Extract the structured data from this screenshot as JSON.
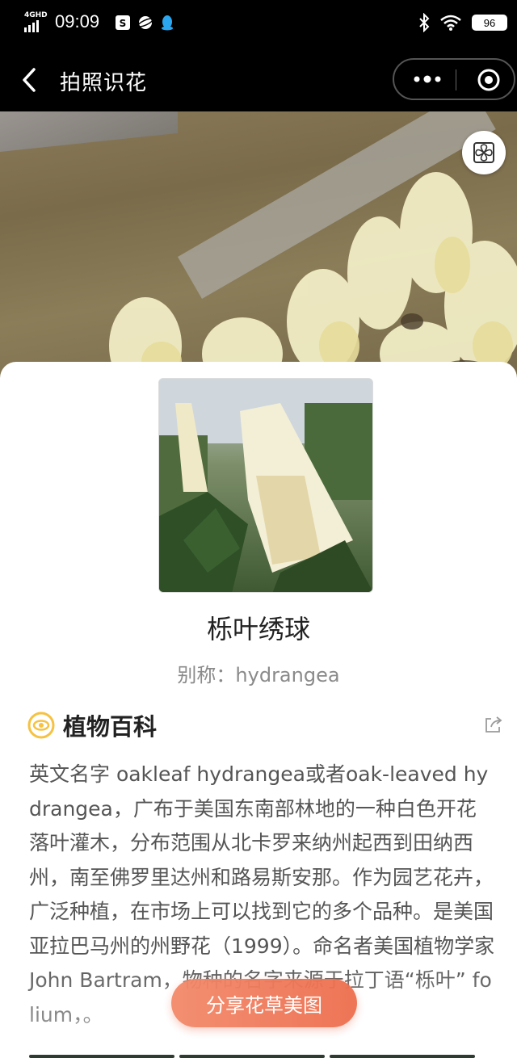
{
  "status_bar": {
    "network": "4GHD",
    "time": "09:09",
    "battery": "96",
    "icons_left": [
      "soul-app-icon",
      "planet-icon",
      "qq-icon"
    ],
    "icons_right": [
      "bluetooth-icon",
      "wifi-icon",
      "battery-icon"
    ]
  },
  "nav": {
    "title": "拍照识花"
  },
  "plant": {
    "name": "栎叶绣球",
    "alias": "别称：hydrangea"
  },
  "encyclopedia": {
    "title": "植物百科",
    "description": "英文名字 oakleaf hydrangea或者oak-leaved hydrangea，广布于美国东南部林地的一种白色开花落叶灌木，分布范围从北卡罗来纳州起西到田纳西州，南至佛罗里达州和路易斯安那。作为园艺花卉，广泛种植，在市场上可以找到它的多个品种。是美国亚拉巴马州的州野花（1999）。命名者美国植物学家John Bartram，物种的名字来源于拉丁语“栎叶” folium，。"
  },
  "actions": {
    "share_label": "分享花草美图"
  },
  "colors": {
    "accent": "#ee6e4e",
    "section_icon": "#f5c242"
  }
}
